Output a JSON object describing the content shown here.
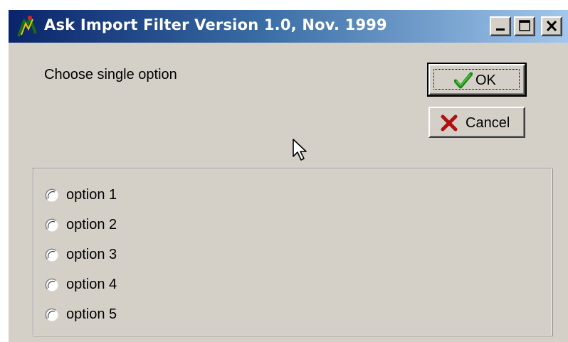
{
  "window": {
    "title": "Ask Import Filter Version 1.0, Nov. 1999",
    "icon": "app-icon",
    "controls": {
      "minimize": "minimize-icon",
      "maximize": "maximize-icon",
      "close": "close-icon"
    }
  },
  "dialog": {
    "prompt": "Choose single option",
    "ok_label": "OK",
    "cancel_label": "Cancel",
    "ok_icon": "checkmark-icon",
    "cancel_icon": "x-icon"
  },
  "options": [
    {
      "label": "option 1",
      "selected": false
    },
    {
      "label": "option 2",
      "selected": false
    },
    {
      "label": "option 3",
      "selected": false
    },
    {
      "label": "option 4",
      "selected": false
    },
    {
      "label": "option 5",
      "selected": false
    }
  ],
  "colors": {
    "title_bar_start": "#0a246a",
    "title_bar_end": "#a6caf0",
    "face": "#d4d0c8",
    "ok_check": "#1c8a1c",
    "cancel_x": "#b01010"
  }
}
